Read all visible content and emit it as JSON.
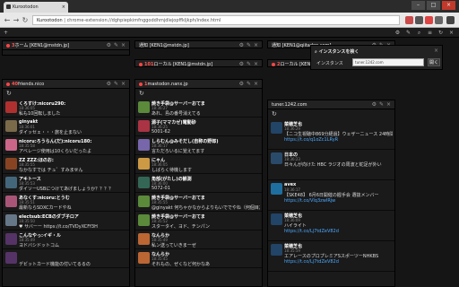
{
  "browser": {
    "tab_title": "Kurootodon",
    "url_scheme": "Kurootodon",
    "url_path": "chrome-extension://dghpiepkimfnggoddhmjdlejopffkljkph/index.html"
  },
  "app": {
    "columns": [
      {
        "num": "3",
        "title": "ホーム [KEN1@mstdn.jp]",
        "has_refresh": false,
        "posts": []
      },
      {
        "num": "",
        "title": "通知 [KEN1@mstdn.jp]",
        "has_refresh": false,
        "posts": []
      },
      {
        "num": "101",
        "title": "ローカル [KEN1@mstdn.jp]",
        "has_refresh": false,
        "posts": []
      },
      {
        "num": "",
        "title": "通知 [KEN1@qiitadon.com]",
        "has_refresh": false,
        "posts": []
      },
      {
        "num": "2",
        "title": "ローカル [KEN1@qiitadon.com]",
        "has_refresh": false,
        "posts": []
      },
      {
        "num": "40",
        "title": "friends.nico",
        "has_refresh": true,
        "posts": [
          {
            "name": "くろすけ:nicoru290:",
            "meta": "18:36:05",
            "text": "私も10回転しました",
            "c": "#b03030"
          },
          {
            "name": "ginyakt",
            "meta": "18:36:01",
            "text": "ダイッセェ・・・旅を止まない",
            "c": "#7a6a4a"
          },
          {
            "name": "nicoru:ろうらん(だ):nicoru180:",
            "meta": "18:35:58",
            "text": "アベレージ使用は10くらいだったよ",
            "c": "#cc6688"
          },
          {
            "name": "ZZ ZZZ:ほのお:",
            "meta": "18:35:55",
            "text": "なかなすでは チュ゛すみません",
            "c": "#884422"
          },
          {
            "name": "アキトース",
            "meta": "18:35:53",
            "text": "ダイソーUSBにつけてあげましょうか？？？？",
            "c": "#44667a"
          },
          {
            "name": "あなくす:nicoru:とうむ",
            "meta": "18:35:51",
            "text": "最新ならSDXCカードやね",
            "c": "#aa5577"
          },
          {
            "name": "electsub:ECBのダブ子ロア",
            "meta": "18:35:50",
            "text": "♥ サバーー https://t.co/TVDyXCFf3H",
            "c": "#667788"
          },
          {
            "name": "こんなやっ:イギ・ル",
            "meta": "18:35:49",
            "text": "ヨドバシドットコム",
            "c": "#553366"
          },
          {
            "name": "",
            "meta": "",
            "text": "デビットカード機能の付いてるるの",
            "c": "#553366"
          }
        ]
      },
      {
        "num": "1",
        "title": "mastodon.nanx.jp",
        "has_refresh": true,
        "posts": [
          {
            "name": "焼き手袋@サーバーおてま",
            "meta": "18:36:27",
            "text": "あれ、島の番号消えてる",
            "c": "#5a8a3a"
          },
          {
            "name": "源子(ママカゼ)電動砂",
            "meta": "18:36:25",
            "text": "5001-62",
            "c": "#aa3344"
          },
          {
            "name": "しらむん@みそだし(自称の野郎)",
            "meta": "18:36:17",
            "text": "言ただろいるに覚えてます",
            "c": "#7766aa"
          },
          {
            "name": "にゃん",
            "meta": "18:36:05",
            "text": "しばらく待機します",
            "c": "#cc9944"
          },
          {
            "name": "角部(がたし)の観測",
            "meta": "18:36:00",
            "text": "5072-01",
            "c": "#336655"
          },
          {
            "name": "焼き手袋@サーバーおてま",
            "meta": "18:35:55",
            "text": "@ginyakt 何ちゃかなからよりもいででやね（何個目だけ",
            "c": "#5a8a3a"
          },
          {
            "name": "焼き手袋@サーバーおてま",
            "meta": "18:35:52",
            "text": "スタータイ、ヨド、チンパン",
            "c": "#5a8a3a"
          },
          {
            "name": "なんらか",
            "meta": "18:35:49",
            "text": "私ン送っていきまーぜ",
            "c": "#bb6633"
          },
          {
            "name": "なんらか",
            "meta": "18:35:45",
            "text": "それもの、ぜくなど何かなあ",
            "c": "#bb6633"
          }
        ]
      },
      {
        "num": "",
        "title": "tuner.1242.com",
        "has_refresh": true,
        "posts": [
          {
            "name": "菜穂芝也",
            "meta": "18:36:29",
            "text": "【ニコ生視聴中869分経過】ウェザーニュース 24時間天気番組生放送",
            "text2": "https://t.co/q1oZc1LRyR",
            "c": "#224466"
          },
          {
            "name": "日本の",
            "meta": "18:36:23",
            "text": "日々んが向けた HBC ラジオの周波と蛇足が外い",
            "text2": "",
            "c": "#2a4a6a"
          },
          {
            "name": "avex",
            "meta": "18:36:17",
            "text": "【SKE48】 6月6日開催の握手会 選抜メンバー",
            "text2": "https://t.co/Vlq3zwIRjw",
            "c": "#1e6fa0"
          },
          {
            "name": "菜穂芝也",
            "meta": "18:36:09",
            "text": "ハイライト",
            "text2": "https://t.co/Lj7tdZeV82d",
            "c": "#224466"
          },
          {
            "name": "菜穂芝也",
            "meta": "18:35:59",
            "text": "エアレースのプロプレミアSスポーツーNHKBS",
            "text2": "https://t.co/Lj7tdZeV82d",
            "c": "#224466"
          }
        ]
      }
    ],
    "search_panel": {
      "title": "インスタンスを検く",
      "label": "インスタンス",
      "input_value": "tuner.1242.com",
      "button": "開く"
    }
  }
}
